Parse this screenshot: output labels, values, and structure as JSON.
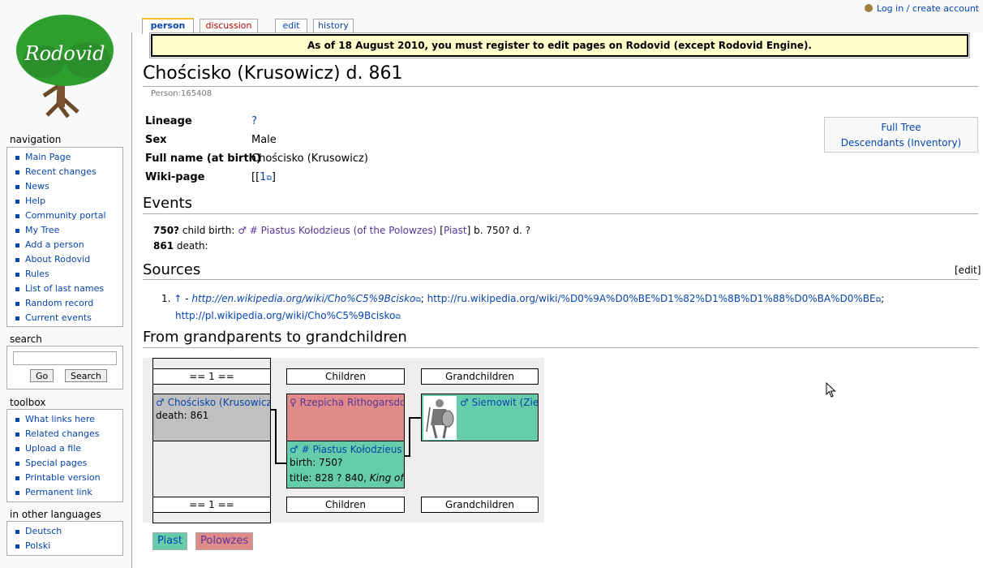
{
  "user": {
    "login_label": "Log in / create account"
  },
  "tabs": [
    {
      "label": "person"
    },
    {
      "label": "discussion"
    },
    {
      "label": "edit"
    },
    {
      "label": "history"
    }
  ],
  "notice": "As of 18 August 2010, you must register to edit pages on Rodovid (except Rodovid Engine).",
  "logo_text": "Rodovid",
  "sidebar": {
    "navigation": {
      "title": "navigation",
      "items": [
        "Main Page",
        "Recent changes",
        "News",
        "Help",
        "Community portal",
        "My Tree",
        "Add a person",
        "About Rodovid",
        "Rules",
        "List of last names",
        "Random record",
        "Current events"
      ]
    },
    "search": {
      "title": "search",
      "go": "Go",
      "search": "Search"
    },
    "toolbox": {
      "title": "toolbox",
      "items": [
        "What links here",
        "Related changes",
        "Upload a file",
        "Special pages",
        "Printable version",
        "Permanent link"
      ]
    },
    "languages": {
      "title": "in other languages",
      "items": [
        "Deutsch",
        "Polski"
      ]
    }
  },
  "page": {
    "title": "Chościsko (Krusowicz) d. 861",
    "subtitle": "Person:165408",
    "info": [
      {
        "label": "Lineage",
        "value": "?"
      },
      {
        "label": "Sex",
        "value": "Male"
      },
      {
        "label": "Full name (at birth)",
        "value": "Chościsko (Krusowicz)"
      },
      {
        "label": "Wiki-page",
        "value_pre": "[[",
        "value_link": "1",
        "value_post": "]"
      }
    ],
    "fulltree": {
      "line1": "Full Tree",
      "line2": "Descendants (Inventory)"
    }
  },
  "events": {
    "title": "Events",
    "e1": {
      "year": "750?",
      "type": "child birth:",
      "person": "♂ # Piastus Kołodzieus (of the Polowzes)",
      "lin_pre": "[",
      "lin": "Piast",
      "lin_post": "]",
      "rest": "b. 750? d. ?"
    },
    "e2": {
      "year": "861",
      "type": "death:"
    }
  },
  "sources": {
    "title": "Sources",
    "edit": "[edit]",
    "num": "1.",
    "arrow": "↑",
    "dash": "-",
    "link1": "http://en.wikipedia.org/wiki/Cho%C5%9Bcisko",
    "sep1": ";",
    "link2": "http://ru.wikipedia.org/wiki/%D0%9A%D0%BE%D1%82%D1%8B%D1%88%D0%BA%D0%BE",
    "sep2": ";",
    "link3": "http://pl.wikipedia.org/wiki/Cho%C5%9Bcisko"
  },
  "tree": {
    "title": "From grandparents to grandchildren",
    "gen_label": "== 1 ==",
    "children": "Children",
    "grandchildren": "Grandchildren",
    "self": {
      "name": "♂ Chościsko (Krusowicz)",
      "line1": "death: 861"
    },
    "spouse": {
      "name": "♀ Rzepicha Rithogarsdotter"
    },
    "child": {
      "name": "♂ # Piastus Kołodzieus",
      "line1": "birth: 750?",
      "line2_pre": "title: 828 ? 840, ",
      "line2_em": "King of the Polans"
    },
    "grandchild": {
      "name": "♂ Siemowit (Ziemowit)"
    }
  },
  "legend": [
    {
      "label": "Piast",
      "color": "#66cdaa"
    },
    {
      "label": "Polowzes",
      "color": "#e08a8a"
    }
  ],
  "colors": {
    "gray": "#c0c0c0",
    "pink": "#e08a8a",
    "green": "#66cdaa"
  }
}
